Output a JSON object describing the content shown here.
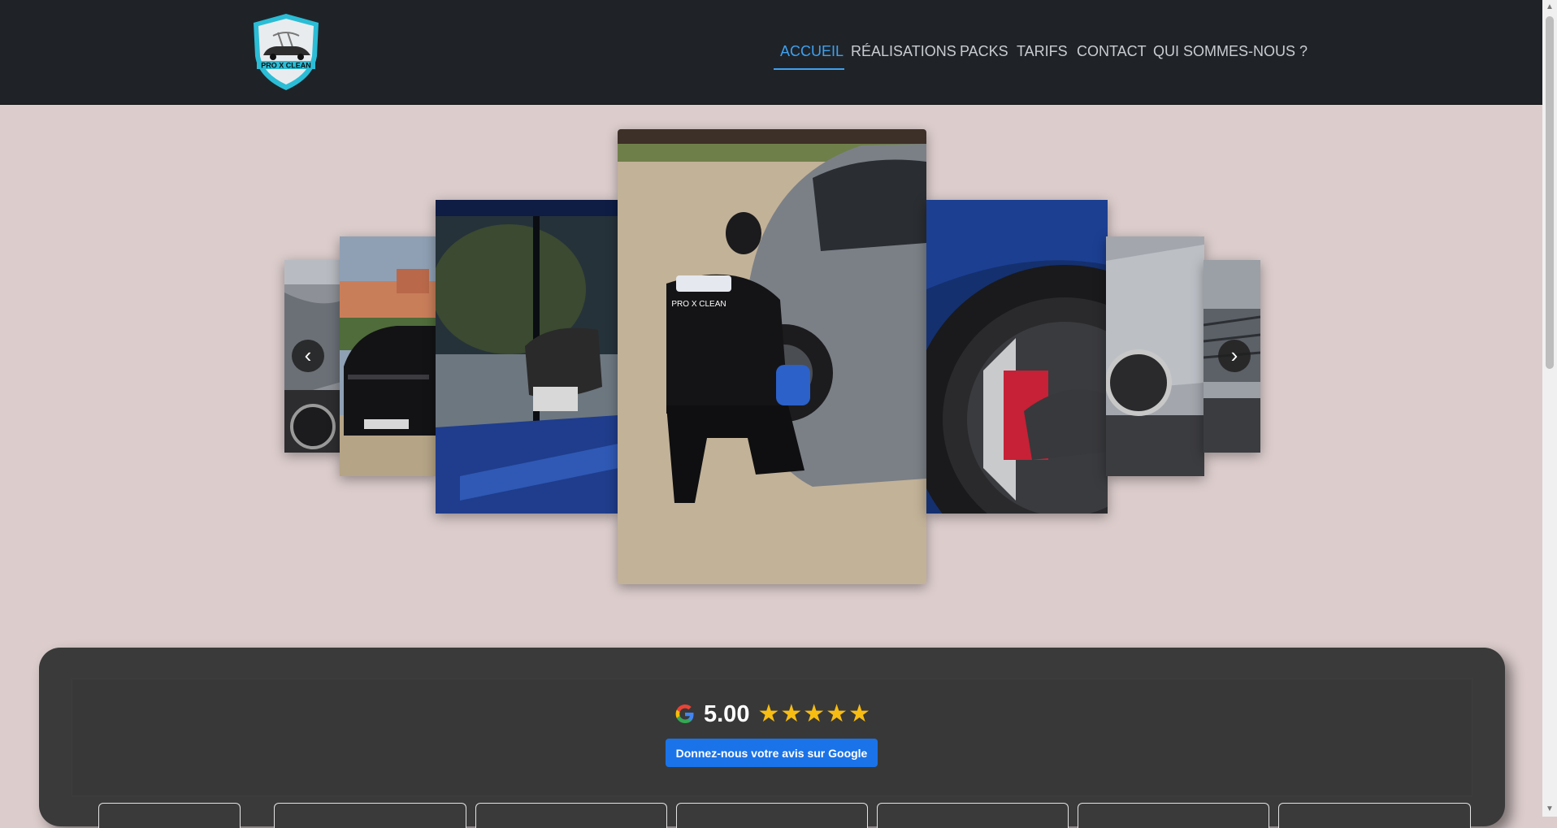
{
  "brand": {
    "logo_text": "PRO X CLEAN",
    "accent_color": "#3ea0f0"
  },
  "nav": {
    "items": [
      {
        "label": "ACCUEIL",
        "active": true
      },
      {
        "label": "RÉALISATIONS",
        "active": false
      },
      {
        "label": "PACKS",
        "active": false
      },
      {
        "label": "TARIFS",
        "active": false
      },
      {
        "label": "CONTACT",
        "active": false
      },
      {
        "label": "QUI SOMMES-NOUS ?",
        "active": false
      }
    ]
  },
  "carousel": {
    "prev_label": "‹",
    "next_label": "›",
    "hoodie_text": "PRO X CLEAN"
  },
  "reviews": {
    "rating": "5.00",
    "stars": 5,
    "google_button": "Donnez-nous votre avis sur Google"
  }
}
